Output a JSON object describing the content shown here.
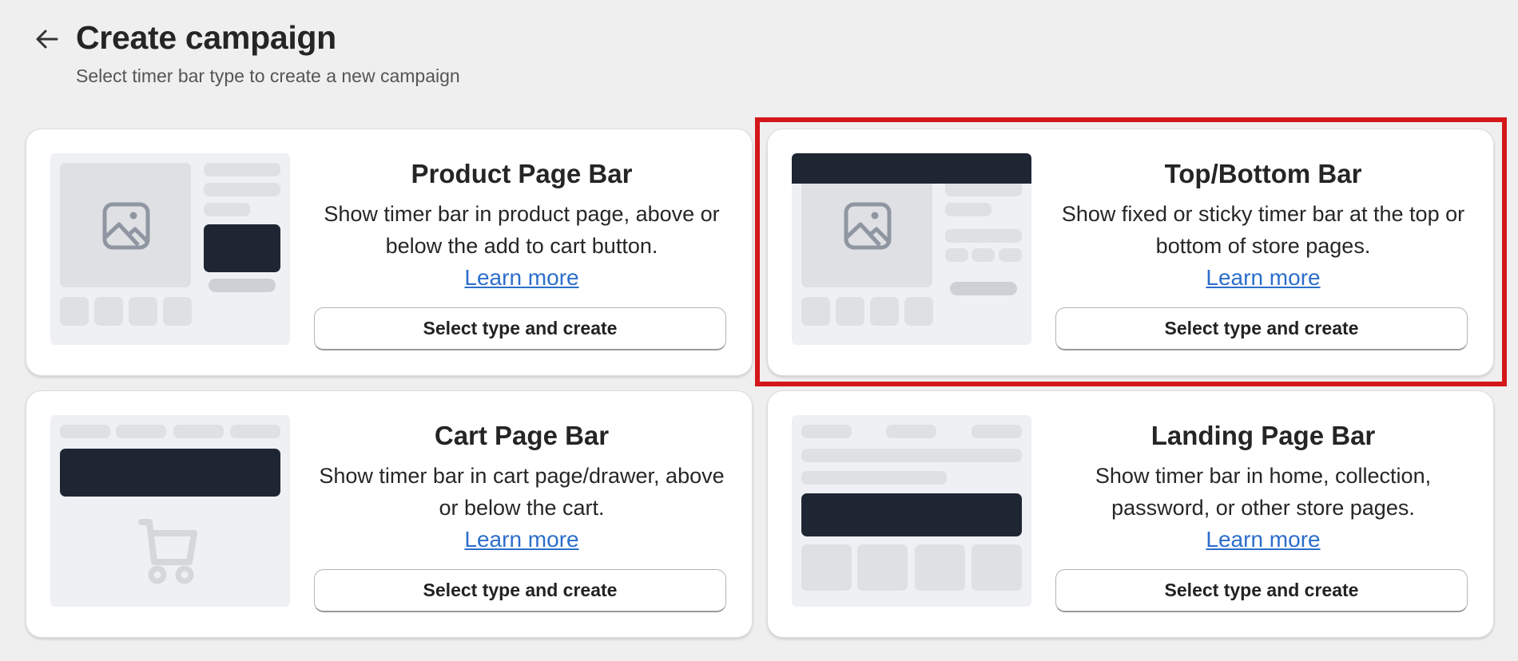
{
  "header": {
    "title": "Create campaign",
    "subtitle": "Select timer bar type to create a new campaign",
    "back_icon": "arrow-left-icon"
  },
  "cards": [
    {
      "title": "Product Page Bar",
      "description": "Show timer bar in product page, above or below the add to cart button.",
      "link": "Learn more",
      "button": "Select type and create",
      "preview_icon": "image-icon"
    },
    {
      "title": "Top/Bottom Bar",
      "description": "Show fixed or sticky timer bar at the top or bottom of store pages.",
      "link": "Learn more",
      "button": "Select type and create",
      "preview_icon": "image-icon",
      "highlighted": true
    },
    {
      "title": "Cart Page Bar",
      "description": "Show timer bar in cart page/drawer, above or below the cart.",
      "link": "Learn more",
      "button": "Select type and create",
      "preview_icon": "cart-icon"
    },
    {
      "title": "Landing Page Bar",
      "description": "Show timer bar in home, collection, password, or other store pages.",
      "link": "Learn more",
      "button": "Select type and create",
      "preview_icon": "none"
    }
  ],
  "colors": {
    "background": "#efefef",
    "dark_block": "#1f2633",
    "light_block": "#dfe0e4",
    "link": "#2c6ecb",
    "highlight": "#d3171a"
  }
}
